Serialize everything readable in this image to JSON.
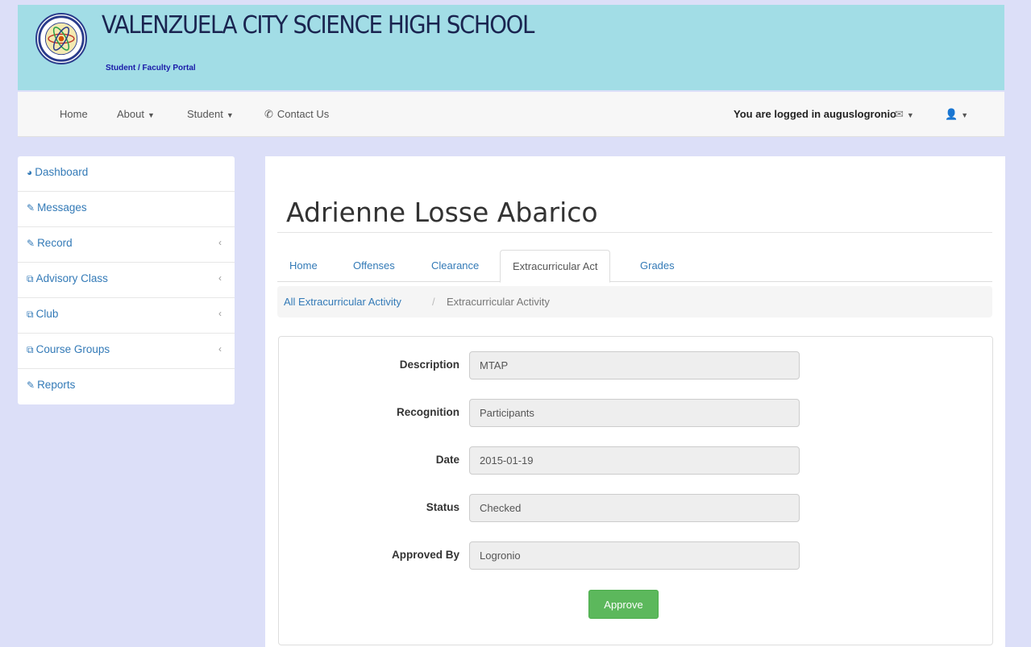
{
  "header": {
    "school_name": "VALENZUELA CITY SCIENCE HIGH SCHOOL",
    "subtitle": "Student / Faculty Portal"
  },
  "navbar": {
    "items": [
      {
        "label": "Home"
      },
      {
        "label": "About"
      },
      {
        "label": "Student"
      },
      {
        "label": "Contact Us"
      }
    ],
    "logged_in_text": "You are logged in auguslogronio"
  },
  "sidebar": {
    "items": [
      {
        "label": "Dashboard",
        "icon": "dashboard-icon"
      },
      {
        "label": "Messages",
        "icon": "edit-icon"
      },
      {
        "label": "Record",
        "icon": "edit-icon"
      },
      {
        "label": "Advisory Class",
        "icon": "copy-icon"
      },
      {
        "label": "Club",
        "icon": "copy-icon"
      },
      {
        "label": "Course Groups",
        "icon": "copy-icon"
      },
      {
        "label": "Reports",
        "icon": "edit-icon"
      }
    ]
  },
  "main": {
    "student_name": "Adrienne Losse Abarico",
    "tabs": [
      {
        "label": "Home"
      },
      {
        "label": "Offenses"
      },
      {
        "label": "Clearance"
      },
      {
        "label": "Extracurricular Act",
        "active": true
      },
      {
        "label": "Grades"
      }
    ],
    "breadcrumb": {
      "link": "All Extracurricular Activity",
      "separator": "/",
      "current": "Extracurricular Activity"
    },
    "form": {
      "fields": [
        {
          "label": "Description",
          "value": "MTAP"
        },
        {
          "label": "Recognition",
          "value": "Participants"
        },
        {
          "label": "Date",
          "value": "2015-01-19"
        },
        {
          "label": "Status",
          "value": "Checked"
        },
        {
          "label": "Approved By",
          "value": "Logronio"
        }
      ],
      "approve_label": "Approve"
    }
  },
  "colors": {
    "header_bg": "#a2dde6",
    "page_bg": "#dcdff8",
    "link": "#337ab7",
    "approve": "#5cb85c"
  }
}
